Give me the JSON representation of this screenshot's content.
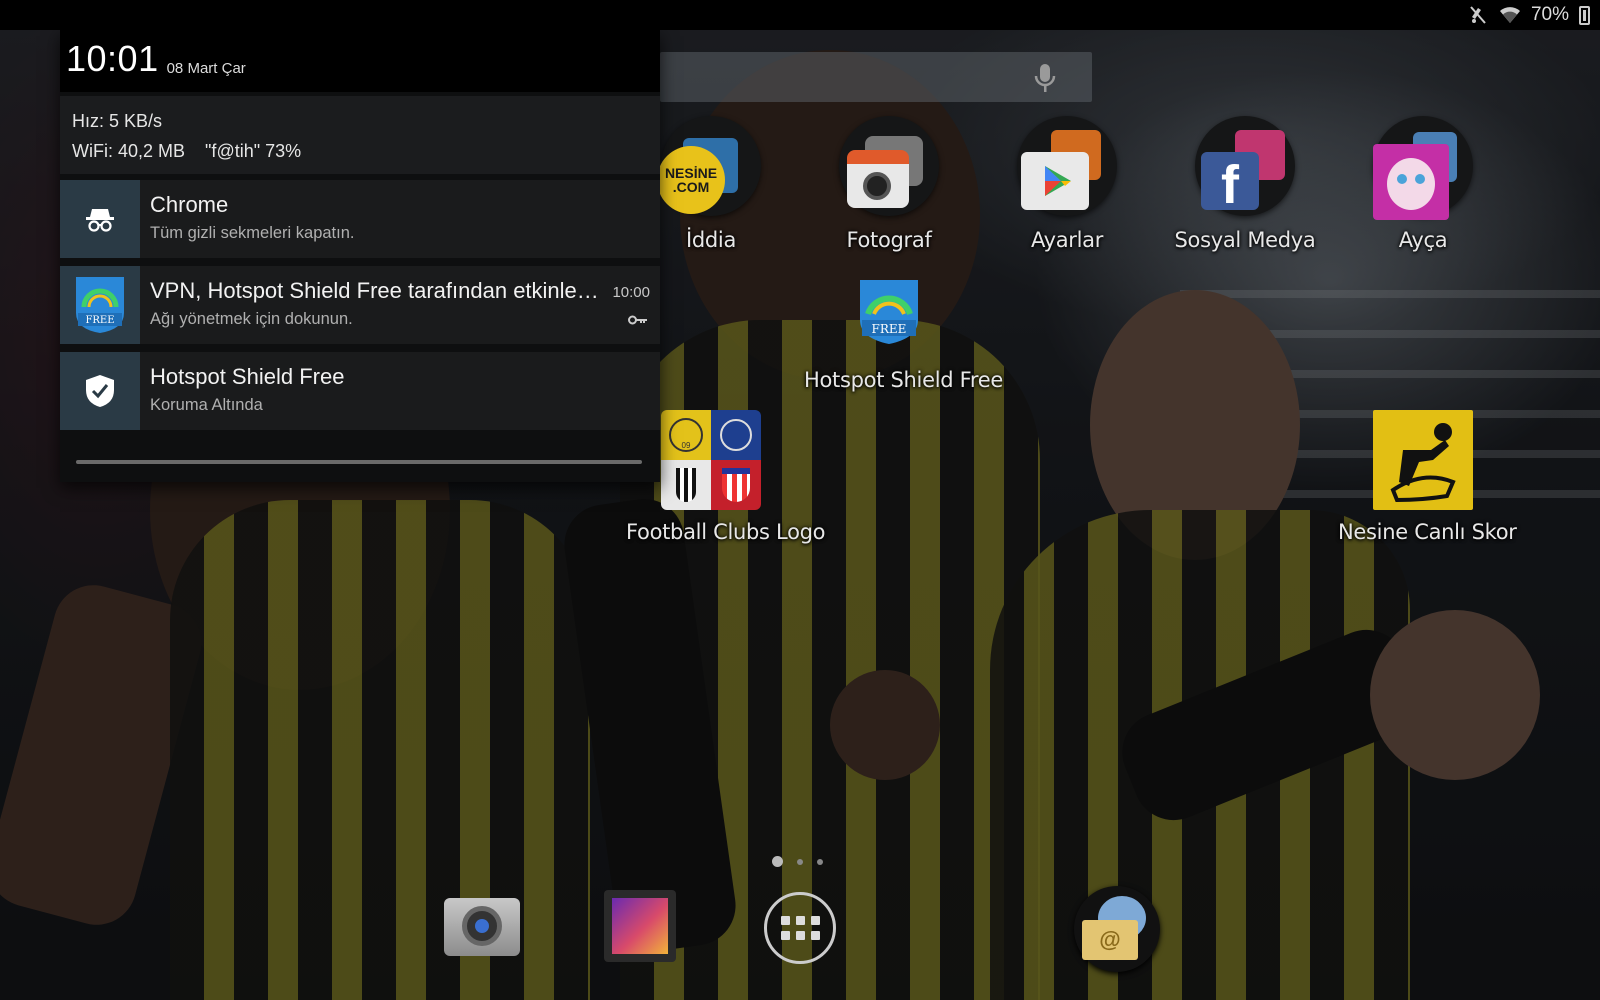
{
  "status_bar": {
    "battery_text": "70%",
    "icons": [
      "mute-icon",
      "wifi-icon",
      "battery-icon"
    ]
  },
  "notification_shade": {
    "time": "10:01",
    "date": "08 Mart Çar",
    "net_speed": "Hız: 5 KB/s",
    "wifi_usage": "WiFi: 40,2 MB",
    "wifi_name": "\"f@tih\"",
    "wifi_signal": "73%",
    "notifications": [
      {
        "app": "Chrome",
        "title": "Chrome",
        "text": "Tüm gizli sekmeleri kapatın.",
        "icon": "incognito-icon"
      },
      {
        "app": "Hotspot Shield Free",
        "title": "VPN, Hotspot Shield Free tarafından etkinleştirildi",
        "text": "Ağı yönetmek için dokunun.",
        "time": "10:00",
        "icon": "hotspot-shield-icon",
        "badge_icon": "vpn-key-icon"
      },
      {
        "app": "Hotspot Shield Free",
        "title": "Hotspot Shield Free",
        "text": "Koruma Altında",
        "icon": "shield-check-icon"
      }
    ]
  },
  "home_screen": {
    "apps": [
      {
        "label": "İddia",
        "icon": "folder-icon"
      },
      {
        "label": "Fotograf",
        "icon": "folder-icon"
      },
      {
        "label": "Ayarlar",
        "icon": "folder-icon"
      },
      {
        "label": "Sosyal Medya",
        "icon": "folder-icon"
      },
      {
        "label": "Ayça",
        "icon": "folder-icon"
      },
      {
        "label": "Hotspot Shield Free",
        "icon": "hotspot-shield-icon",
        "badge": "FREE"
      },
      {
        "label": "Football Clubs Logo",
        "icon": "football-clubs-icon"
      },
      {
        "label": "Nesine Canlı Skor",
        "icon": "nesine-canli-skor-icon"
      }
    ],
    "folder_texts": {
      "nesine": "NESİNE .COM",
      "free": "FREE",
      "club_badge": "09"
    },
    "page_indicator": {
      "pages": 3,
      "current": 1
    },
    "dock": [
      "camera-icon",
      "gallery-icon",
      "all-apps-icon",
      "email-icon"
    ]
  },
  "colors": {
    "shade_bg": "#0e0f10",
    "notif_bg": "#1a1b1c",
    "notif_icon_bg": "#2a3a45",
    "accent_yellow": "#e8c21a"
  }
}
